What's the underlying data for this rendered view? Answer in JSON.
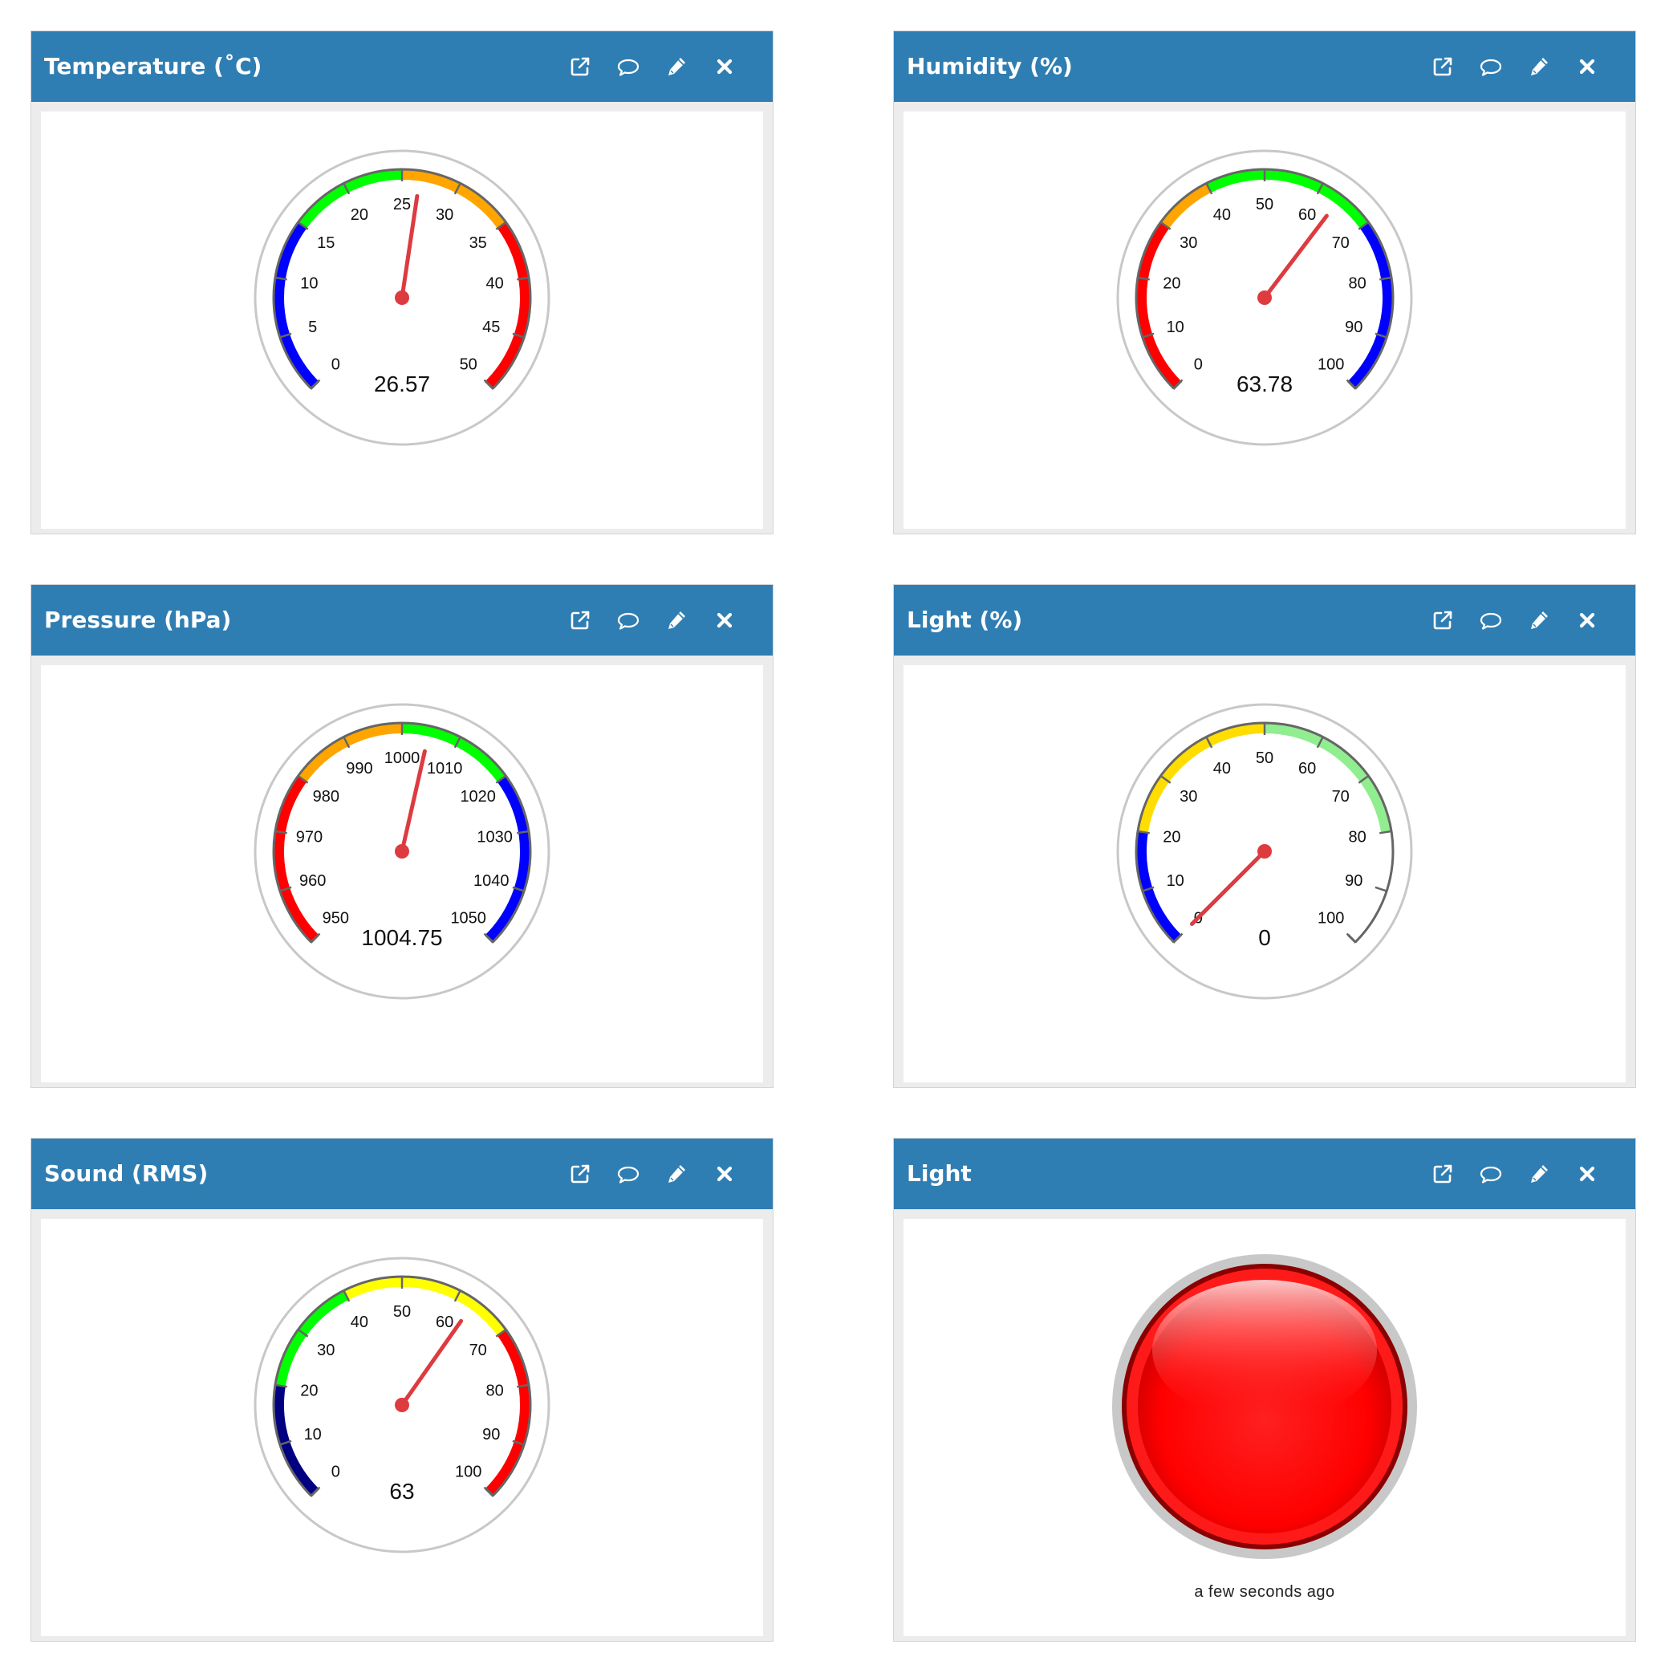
{
  "colors": {
    "header_bg": "#2f7eb3",
    "needle": "#dd3b3f",
    "blue": "#0000ff",
    "green": "#00ff00",
    "orange": "#ffa500",
    "red": "#ff0000",
    "yellow": "#ffff00",
    "gold": "#ffdd00",
    "lightgreen": "#90ee90",
    "navy": "#000080",
    "led_red": "#ff0000"
  },
  "actions": [
    {
      "name": "popout-icon",
      "icon": "external-link-icon"
    },
    {
      "name": "comment-icon",
      "icon": "speech-bubble-icon"
    },
    {
      "name": "edit-icon",
      "icon": "pencil-icon"
    },
    {
      "name": "close-icon",
      "icon": "x-icon"
    }
  ],
  "widgets": [
    {
      "title": "Temperature (˚C)",
      "type": "gauge",
      "value": 26.57,
      "value_text": "26.57",
      "min": 0,
      "max": 50,
      "ticks": [
        "0",
        "5",
        "10",
        "15",
        "20",
        "25",
        "30",
        "35",
        "40",
        "45",
        "50"
      ],
      "bands": [
        {
          "from": 0,
          "to": 15,
          "color": "#0000ff"
        },
        {
          "from": 15,
          "to": 25,
          "color": "#00ff00"
        },
        {
          "from": 25,
          "to": 35,
          "color": "#ffa500"
        },
        {
          "from": 35,
          "to": 50,
          "color": "#ff0000"
        }
      ]
    },
    {
      "title": "Humidity (%)",
      "type": "gauge",
      "value": 63.78,
      "value_text": "63.78",
      "min": 0,
      "max": 100,
      "ticks": [
        "0",
        "10",
        "20",
        "30",
        "40",
        "50",
        "60",
        "70",
        "80",
        "90",
        "100"
      ],
      "bands": [
        {
          "from": 0,
          "to": 30,
          "color": "#ff0000"
        },
        {
          "from": 30,
          "to": 40,
          "color": "#ffa500"
        },
        {
          "from": 40,
          "to": 70,
          "color": "#00ff00"
        },
        {
          "from": 70,
          "to": 100,
          "color": "#0000ff"
        }
      ]
    },
    {
      "title": "Pressure (hPa)",
      "type": "gauge",
      "value": 1004.75,
      "value_text": "1004.75",
      "min": 950,
      "max": 1050,
      "ticks": [
        "950",
        "960",
        "970",
        "980",
        "990",
        "1000",
        "1010",
        "1020",
        "1030",
        "1040",
        "1050"
      ],
      "bands": [
        {
          "from": 950,
          "to": 980,
          "color": "#ff0000"
        },
        {
          "from": 980,
          "to": 1000,
          "color": "#ffa500"
        },
        {
          "from": 1000,
          "to": 1020,
          "color": "#00ff00"
        },
        {
          "from": 1020,
          "to": 1050,
          "color": "#0000ff"
        }
      ]
    },
    {
      "title": "Light (%)",
      "type": "gauge",
      "value": 0,
      "value_text": "0",
      "min": 0,
      "max": 100,
      "ticks": [
        "0",
        "10",
        "20",
        "30",
        "40",
        "50",
        "60",
        "70",
        "80",
        "90",
        "100"
      ],
      "bands": [
        {
          "from": 0,
          "to": 20,
          "color": "#0000ff"
        },
        {
          "from": 20,
          "to": 50,
          "color": "#ffdd00"
        },
        {
          "from": 50,
          "to": 80,
          "color": "#90ee90"
        }
      ]
    },
    {
      "title": "Sound (RMS)",
      "type": "gauge",
      "value": 63,
      "value_text": "63",
      "min": 0,
      "max": 100,
      "ticks": [
        "0",
        "10",
        "20",
        "30",
        "40",
        "50",
        "60",
        "70",
        "80",
        "90",
        "100"
      ],
      "bands": [
        {
          "from": 0,
          "to": 20,
          "color": "#000080"
        },
        {
          "from": 20,
          "to": 40,
          "color": "#00ff00"
        },
        {
          "from": 40,
          "to": 70,
          "color": "#ffff00"
        },
        {
          "from": 70,
          "to": 100,
          "color": "#ff0000"
        }
      ]
    },
    {
      "title": "Light",
      "type": "led",
      "state": "on",
      "color": "#ff0000",
      "time_text": "a few seconds ago"
    }
  ]
}
